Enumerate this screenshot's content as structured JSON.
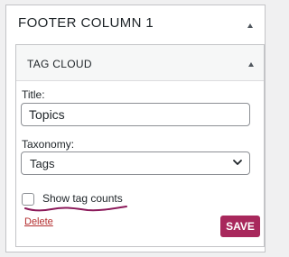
{
  "panel": {
    "title": "FOOTER COLUMN 1"
  },
  "widget": {
    "title": "TAG CLOUD",
    "title_field": {
      "label": "Title:",
      "value": "Topics"
    },
    "taxonomy_field": {
      "label": "Taxonomy:",
      "selected": "Tags"
    },
    "show_counts": {
      "label": "Show tag counts",
      "checked": false
    },
    "delete_label": "Delete",
    "save_label": "SAVE"
  },
  "colors": {
    "accent": "#a8285c",
    "scribble": "#8b1a5a",
    "delete_link": "#b32d2e"
  },
  "icons": {
    "panel_toggle": "triangle-up-icon",
    "widget_toggle": "triangle-up-icon",
    "select_chevron": "chevron-down-icon"
  }
}
